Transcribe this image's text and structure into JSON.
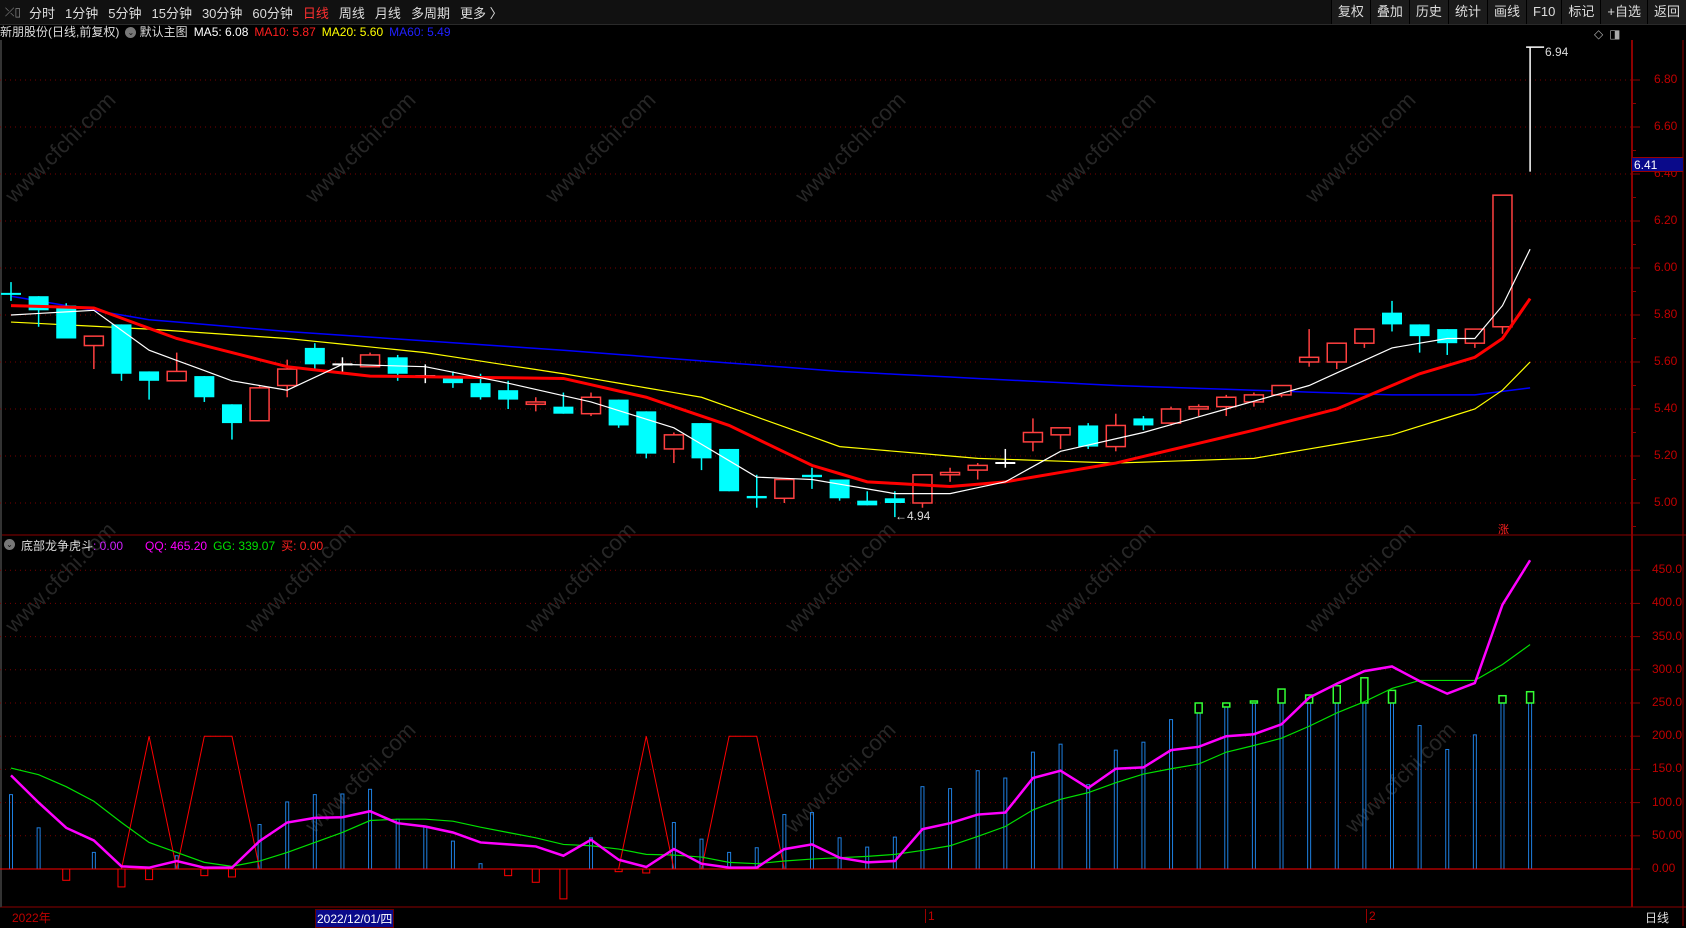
{
  "toolbar": {
    "left_icon": "⤫▯",
    "periods": [
      "分时",
      "1分钟",
      "5分钟",
      "15分钟",
      "30分钟",
      "60分钟",
      "日线",
      "周线",
      "月线",
      "多周期",
      "更多 〉"
    ],
    "active_period": "日线",
    "right_buttons": [
      "复权",
      "叠加",
      "历史",
      "统计",
      "画线",
      "F10",
      "标记",
      "+自选",
      "返回"
    ]
  },
  "info": {
    "stock": "新朋股份(日线,前复权)",
    "main_chart": "默认主图",
    "ma5": "MA5: 6.08",
    "ma10": "MA10: 5.87",
    "ma20": "MA20: 5.60",
    "ma60": "MA60: 5.49"
  },
  "indicator_legend": {
    "name": "底部龙争虎斗",
    "value": ": 0.00",
    "qq": "QQ: 465.20",
    "gg": "GG: 339.07",
    "buy": "买: 0.00"
  },
  "colors": {
    "up": "#ff4040",
    "down": "#00ffff",
    "ma5": "#ffffff",
    "ma10": "#ff0000",
    "ma20": "#ffff00",
    "ma60": "#0000ff",
    "qq": "#ff00ff",
    "gg": "#00e000",
    "axis": "#c00000",
    "vv": "#1e7fe0",
    "box": "#33ff33",
    "buy": "#ff0000"
  },
  "price_axis": {
    "ticks": [
      "5.00",
      "5.20",
      "5.40",
      "5.60",
      "5.80",
      "6.00",
      "6.20",
      "6.40",
      "6.60",
      "6.80"
    ],
    "last_price": "6.41",
    "high_label": "6.94",
    "low_label": "←4.94",
    "limit_mark": "涨"
  },
  "indicator_axis": {
    "ticks": [
      "0.00",
      "50.00",
      "100.0",
      "150.0",
      "200.0",
      "250.0",
      "300.0",
      "350.0",
      "400.0",
      "450.0"
    ]
  },
  "x_axis": {
    "year": "2022年",
    "cursor_date": "2022/12/01/四",
    "month1": "1",
    "month2": "2",
    "period": "日线"
  },
  "watermark": "www.cfchi.com",
  "chart_data": [
    {
      "type": "candlestick",
      "title": "新朋股份(日线,前复权)",
      "ylim": [
        4.9,
        7.0
      ],
      "candles_ohlc": [
        [
          5.89,
          5.94,
          5.86,
          5.89
        ],
        [
          5.88,
          5.88,
          5.75,
          5.82
        ],
        [
          5.84,
          5.85,
          5.7,
          5.7
        ],
        [
          5.67,
          5.71,
          5.57,
          5.71
        ],
        [
          5.76,
          5.76,
          5.52,
          5.55
        ],
        [
          5.56,
          5.56,
          5.44,
          5.52
        ],
        [
          5.52,
          5.64,
          5.52,
          5.56
        ],
        [
          5.54,
          5.54,
          5.43,
          5.45
        ],
        [
          5.42,
          5.42,
          5.27,
          5.34
        ],
        [
          5.35,
          5.5,
          5.35,
          5.49
        ],
        [
          5.5,
          5.61,
          5.45,
          5.57
        ],
        [
          5.66,
          5.68,
          5.57,
          5.59
        ],
        [
          5.59,
          5.62,
          5.55,
          5.59
        ],
        [
          5.58,
          5.64,
          5.58,
          5.63
        ],
        [
          5.62,
          5.63,
          5.52,
          5.55
        ],
        [
          5.54,
          5.59,
          5.51,
          5.54
        ],
        [
          5.53,
          5.56,
          5.49,
          5.51
        ],
        [
          5.51,
          5.55,
          5.44,
          5.45
        ],
        [
          5.48,
          5.52,
          5.4,
          5.44
        ],
        [
          5.42,
          5.45,
          5.39,
          5.43
        ],
        [
          5.41,
          5.47,
          5.38,
          5.38
        ],
        [
          5.38,
          5.47,
          5.37,
          5.45
        ],
        [
          5.44,
          5.44,
          5.32,
          5.33
        ],
        [
          5.39,
          5.39,
          5.19,
          5.21
        ],
        [
          5.23,
          5.3,
          5.17,
          5.29
        ],
        [
          5.34,
          5.34,
          5.14,
          5.19
        ],
        [
          5.23,
          5.23,
          5.05,
          5.05
        ],
        [
          5.03,
          5.12,
          4.98,
          5.02
        ],
        [
          5.02,
          5.1,
          5.0,
          5.1
        ],
        [
          5.12,
          5.15,
          5.06,
          5.11
        ],
        [
          5.1,
          5.1,
          5.01,
          5.02
        ],
        [
          5.01,
          5.05,
          4.99,
          4.99
        ],
        [
          5.02,
          5.05,
          4.94,
          5.0
        ],
        [
          5.0,
          5.12,
          4.98,
          5.12
        ],
        [
          5.12,
          5.15,
          5.09,
          5.13
        ],
        [
          5.14,
          5.17,
          5.1,
          5.16
        ],
        [
          5.17,
          5.23,
          5.15,
          5.17
        ],
        [
          5.26,
          5.36,
          5.22,
          5.3
        ],
        [
          5.29,
          5.32,
          5.23,
          5.32
        ],
        [
          5.33,
          5.34,
          5.23,
          5.24
        ],
        [
          5.24,
          5.38,
          5.22,
          5.33
        ],
        [
          5.36,
          5.37,
          5.31,
          5.33
        ],
        [
          5.34,
          5.41,
          5.33,
          5.4
        ],
        [
          5.4,
          5.42,
          5.37,
          5.41
        ],
        [
          5.41,
          5.46,
          5.37,
          5.45
        ],
        [
          5.43,
          5.47,
          5.41,
          5.46
        ],
        [
          5.46,
          5.5,
          5.45,
          5.5
        ],
        [
          5.6,
          5.74,
          5.58,
          5.62
        ],
        [
          5.6,
          5.68,
          5.57,
          5.68
        ],
        [
          5.68,
          5.74,
          5.66,
          5.74
        ],
        [
          5.81,
          5.86,
          5.73,
          5.76
        ],
        [
          5.76,
          5.76,
          5.64,
          5.71
        ],
        [
          5.74,
          5.74,
          5.63,
          5.68
        ],
        [
          5.68,
          5.74,
          5.66,
          5.74
        ],
        [
          5.75,
          6.31,
          5.72,
          6.31
        ],
        [
          6.94,
          6.94,
          6.41,
          6.94
        ]
      ],
      "ma_keypoints": {
        "MA5": [
          [
            0,
            5.8
          ],
          [
            3,
            5.82
          ],
          [
            5,
            5.65
          ],
          [
            8,
            5.52
          ],
          [
            10,
            5.48
          ],
          [
            12,
            5.59
          ],
          [
            15,
            5.58
          ],
          [
            18,
            5.51
          ],
          [
            21,
            5.43
          ],
          [
            24,
            5.32
          ],
          [
            27,
            5.11
          ],
          [
            29,
            5.1
          ],
          [
            32,
            5.04
          ],
          [
            34,
            5.04
          ],
          [
            36,
            5.09
          ],
          [
            38,
            5.22
          ],
          [
            41,
            5.3
          ],
          [
            44,
            5.4
          ],
          [
            47,
            5.5
          ],
          [
            50,
            5.66
          ],
          [
            52,
            5.7
          ],
          [
            53,
            5.7
          ],
          [
            54,
            5.84
          ],
          [
            55,
            6.08
          ]
        ],
        "MA10": [
          [
            0,
            5.84
          ],
          [
            3,
            5.83
          ],
          [
            6,
            5.7
          ],
          [
            10,
            5.58
          ],
          [
            13,
            5.54
          ],
          [
            20,
            5.53
          ],
          [
            23,
            5.45
          ],
          [
            26,
            5.33
          ],
          [
            29,
            5.16
          ],
          [
            31,
            5.09
          ],
          [
            34,
            5.07
          ],
          [
            36,
            5.09
          ],
          [
            40,
            5.17
          ],
          [
            45,
            5.31
          ],
          [
            48,
            5.4
          ],
          [
            51,
            5.55
          ],
          [
            53,
            5.62
          ],
          [
            54,
            5.7
          ],
          [
            55,
            5.87
          ]
        ],
        "MA20": [
          [
            0,
            5.77
          ],
          [
            5,
            5.74
          ],
          [
            10,
            5.7
          ],
          [
            15,
            5.64
          ],
          [
            20,
            5.55
          ],
          [
            25,
            5.45
          ],
          [
            30,
            5.24
          ],
          [
            35,
            5.19
          ],
          [
            40,
            5.17
          ],
          [
            45,
            5.19
          ],
          [
            50,
            5.29
          ],
          [
            53,
            5.4
          ],
          [
            54,
            5.48
          ],
          [
            55,
            5.6
          ]
        ],
        "MA60": [
          [
            0,
            5.88
          ],
          [
            5,
            5.78
          ],
          [
            10,
            5.73
          ],
          [
            20,
            5.65
          ],
          [
            30,
            5.56
          ],
          [
            40,
            5.5
          ],
          [
            45,
            5.48
          ],
          [
            50,
            5.46
          ],
          [
            53,
            5.46
          ],
          [
            55,
            5.49
          ]
        ]
      }
    },
    {
      "type": "bar+line",
      "title": "底部龙争虎斗",
      "ylim": [
        -50,
        470
      ],
      "vv": [
        112,
        62,
        -17,
        25,
        -27,
        -16,
        20,
        -10,
        -12,
        67,
        101,
        112,
        113,
        120,
        75,
        63,
        42,
        8,
        -10,
        -20,
        -45,
        47,
        -4,
        -6,
        70,
        45,
        25,
        32,
        82,
        85,
        47,
        33,
        48,
        124,
        121,
        148,
        137,
        176,
        188,
        127,
        179,
        191,
        225,
        235,
        244,
        250,
        250,
        250,
        250,
        250,
        250,
        216,
        180,
        202,
        250,
        250
      ],
      "boxes": [
        [
          43,
          235,
          250
        ],
        [
          44,
          244,
          250
        ],
        [
          45,
          250,
          253
        ],
        [
          46,
          250,
          271
        ],
        [
          47,
          250,
          262
        ],
        [
          48,
          250,
          276
        ],
        [
          49,
          250,
          288
        ],
        [
          50,
          250,
          269
        ],
        [
          54,
          250,
          261
        ],
        [
          55,
          250,
          267
        ]
      ],
      "buy": [
        0,
        0,
        0,
        0,
        0,
        200,
        0,
        200,
        200,
        0,
        0,
        0,
        0,
        0,
        0,
        0,
        0,
        0,
        0,
        0,
        0,
        0,
        0,
        200,
        0,
        0,
        200,
        200,
        0,
        0,
        0,
        0,
        0,
        0,
        0,
        0,
        0,
        0,
        0,
        0,
        0,
        0,
        0,
        0,
        0,
        0,
        0,
        0,
        0,
        0,
        0,
        0,
        0,
        0,
        0,
        0
      ],
      "QQ": [
        141,
        100,
        62,
        43,
        4,
        2,
        12,
        2,
        2,
        42,
        70,
        77,
        78,
        87,
        69,
        64,
        55,
        40,
        37,
        34,
        20,
        44,
        14,
        3,
        30,
        8,
        2,
        2,
        30,
        37,
        17,
        10,
        12,
        60,
        69,
        82,
        85,
        137,
        148,
        122,
        151,
        153,
        179,
        184,
        200,
        203,
        218,
        258,
        279,
        298,
        305,
        283,
        264,
        280,
        398,
        465
      ],
      "GG": [
        152,
        142,
        124,
        102,
        70,
        40,
        25,
        10,
        4,
        12,
        25,
        40,
        55,
        73,
        75,
        75,
        72,
        63,
        55,
        47,
        37,
        35,
        30,
        22,
        21,
        18,
        10,
        8,
        12,
        15,
        17,
        19,
        22,
        28,
        35,
        49,
        64,
        89,
        105,
        115,
        130,
        143,
        151,
        158,
        176,
        186,
        197,
        215,
        235,
        252,
        272,
        284,
        284,
        284,
        308,
        338
      ]
    }
  ]
}
